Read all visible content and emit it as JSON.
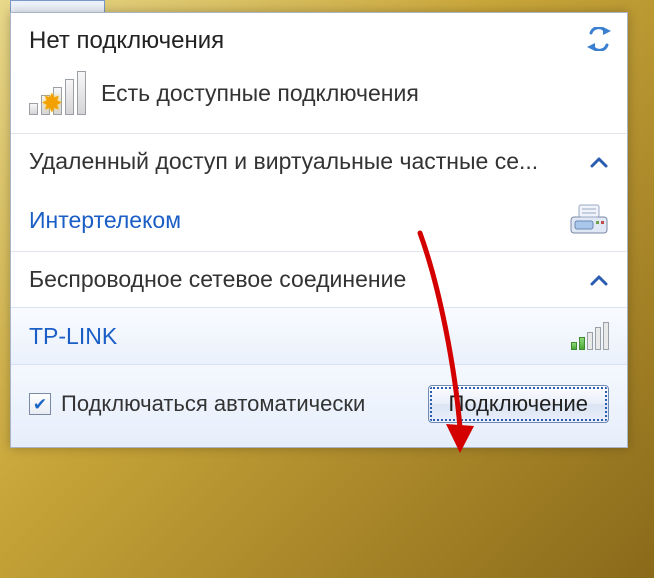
{
  "header": {
    "title": "Нет подключения",
    "available_text": "Есть доступные подключения"
  },
  "sections": {
    "vpn": {
      "label": "Удаленный доступ и виртуальные частные се...",
      "item": {
        "name": "Интертелеком"
      }
    },
    "wifi": {
      "label": "Беспроводное сетевое соединение",
      "item": {
        "name": "TP-LINK"
      }
    }
  },
  "connect_panel": {
    "auto_label": "Подключаться автоматически",
    "button_label": "Подключение",
    "checked": true
  },
  "colors": {
    "link": "#1a5ec6",
    "accent": "#2a5db0"
  }
}
